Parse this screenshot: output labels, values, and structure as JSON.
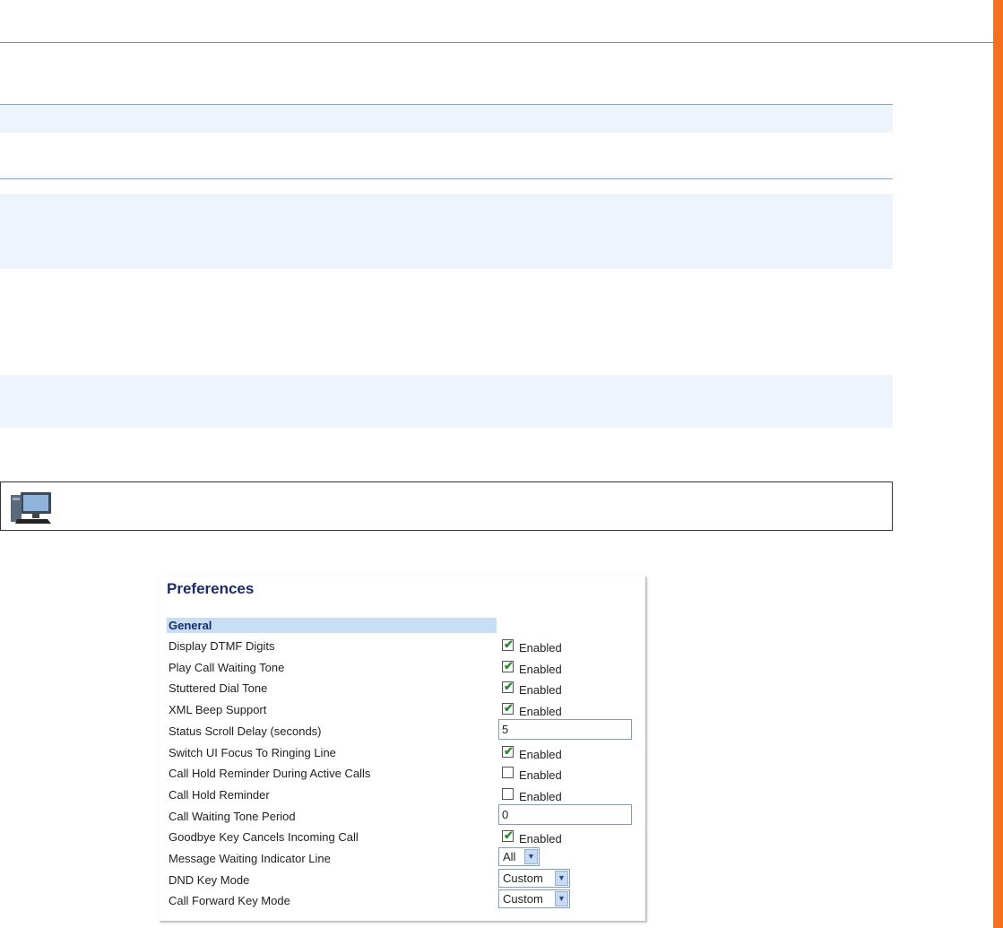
{
  "panel": {
    "title": "Preferences",
    "section": "General",
    "rows": [
      {
        "label": "Display DTMF Digits",
        "type": "checkbox",
        "checked": true,
        "value_label": "Enabled"
      },
      {
        "label": "Play Call Waiting Tone",
        "type": "checkbox",
        "checked": true,
        "value_label": "Enabled"
      },
      {
        "label": "Stuttered Dial Tone",
        "type": "checkbox",
        "checked": true,
        "value_label": "Enabled"
      },
      {
        "label": "XML Beep Support",
        "type": "checkbox",
        "checked": true,
        "value_label": "Enabled"
      },
      {
        "label": "Status Scroll Delay (seconds)",
        "type": "text",
        "value": "5"
      },
      {
        "label": "Switch UI Focus To Ringing Line",
        "type": "checkbox",
        "checked": true,
        "value_label": "Enabled"
      },
      {
        "label": "Call Hold Reminder During Active Calls",
        "type": "checkbox",
        "checked": false,
        "value_label": "Enabled"
      },
      {
        "label": "Call Hold Reminder",
        "type": "checkbox",
        "checked": false,
        "value_label": "Enabled"
      },
      {
        "label": "Call Waiting Tone Period",
        "type": "text",
        "value": "0"
      },
      {
        "label": "Goodbye Key Cancels Incoming Call",
        "type": "checkbox",
        "checked": true,
        "value_label": "Enabled"
      },
      {
        "label": "Message Waiting Indicator Line",
        "type": "select",
        "value": "All"
      },
      {
        "label": "DND Key Mode",
        "type": "select",
        "value": "Custom"
      },
      {
        "label": "Call Forward Key Mode",
        "type": "select",
        "value": "Custom"
      }
    ]
  },
  "note_icon": "computer-icon",
  "colors": {
    "accent": "#f37021",
    "band": "#eef4fb",
    "section": "#c6dff5",
    "title": "#1a2a6c"
  }
}
